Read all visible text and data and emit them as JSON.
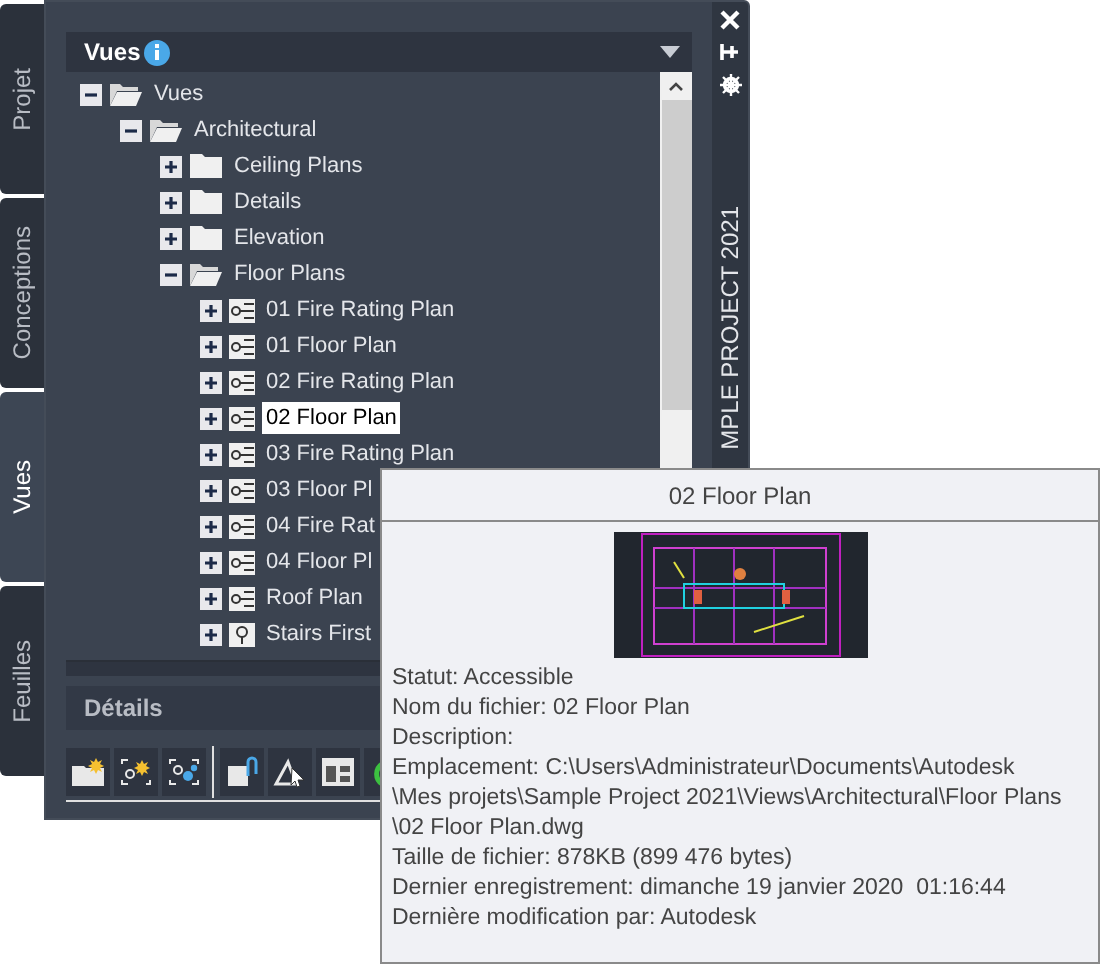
{
  "side_tabs": [
    {
      "label": "Projet",
      "selected": false
    },
    {
      "label": "Conceptions",
      "selected": false
    },
    {
      "label": "Vues",
      "selected": true
    },
    {
      "label": "Feuilles",
      "selected": false
    }
  ],
  "panel": {
    "title": "Vues",
    "details_title": "Détails",
    "project_label": "MPLE PROJECT 2021"
  },
  "tree": [
    {
      "label": "Vues",
      "kind": "folder",
      "expanded": true,
      "selected": false,
      "children": [
        {
          "label": "Architectural",
          "kind": "folder",
          "expanded": true,
          "selected": false,
          "children": [
            {
              "label": "Ceiling Plans",
              "kind": "folder",
              "expanded": false,
              "selected": false
            },
            {
              "label": "Details",
              "kind": "folder",
              "expanded": false,
              "selected": false
            },
            {
              "label": "Elevation",
              "kind": "folder",
              "expanded": false,
              "selected": false
            },
            {
              "label": "Floor Plans",
              "kind": "folder",
              "expanded": true,
              "selected": false,
              "children": [
                {
                  "label": "01 Fire Rating Plan",
                  "kind": "view",
                  "expanded": false,
                  "selected": false
                },
                {
                  "label": "01 Floor Plan",
                  "kind": "view",
                  "expanded": false,
                  "selected": false
                },
                {
                  "label": "02 Fire Rating Plan",
                  "kind": "view",
                  "expanded": false,
                  "selected": false
                },
                {
                  "label": "02 Floor Plan",
                  "kind": "view",
                  "expanded": false,
                  "selected": true
                },
                {
                  "label": "03 Fire Rating Plan",
                  "kind": "view",
                  "expanded": false,
                  "selected": false
                },
                {
                  "label": "03 Floor Pl",
                  "kind": "view",
                  "expanded": false,
                  "selected": false
                },
                {
                  "label": "04 Fire Rat",
                  "kind": "view",
                  "expanded": false,
                  "selected": false
                },
                {
                  "label": "04 Floor Pl",
                  "kind": "view",
                  "expanded": false,
                  "selected": false
                },
                {
                  "label": "Roof Plan",
                  "kind": "view",
                  "expanded": false,
                  "selected": false
                },
                {
                  "label": "Stairs First",
                  "kind": "section",
                  "expanded": false,
                  "selected": false
                }
              ]
            }
          ]
        }
      ]
    }
  ],
  "tooltip": {
    "title": "02 Floor Plan",
    "preview": {
      "kind": "picture"
    },
    "lines": [
      "Statut: Accessible",
      "Nom du fichier: 02 Floor Plan",
      "Description:",
      "Emplacement: C:\\Users\\Administrateur\\Documents\\Autodesk",
      "\\Mes projets\\Sample Project 2021\\Views\\Architectural\\Floor Plans",
      "\\02 Floor Plan.dwg",
      "Taille de fichier: 878KB (899 476 bytes)",
      "Dernier enregistrement: dimanche 19 janvier 2020  01:16:44",
      "Dernière modification par: Autodesk"
    ]
  }
}
